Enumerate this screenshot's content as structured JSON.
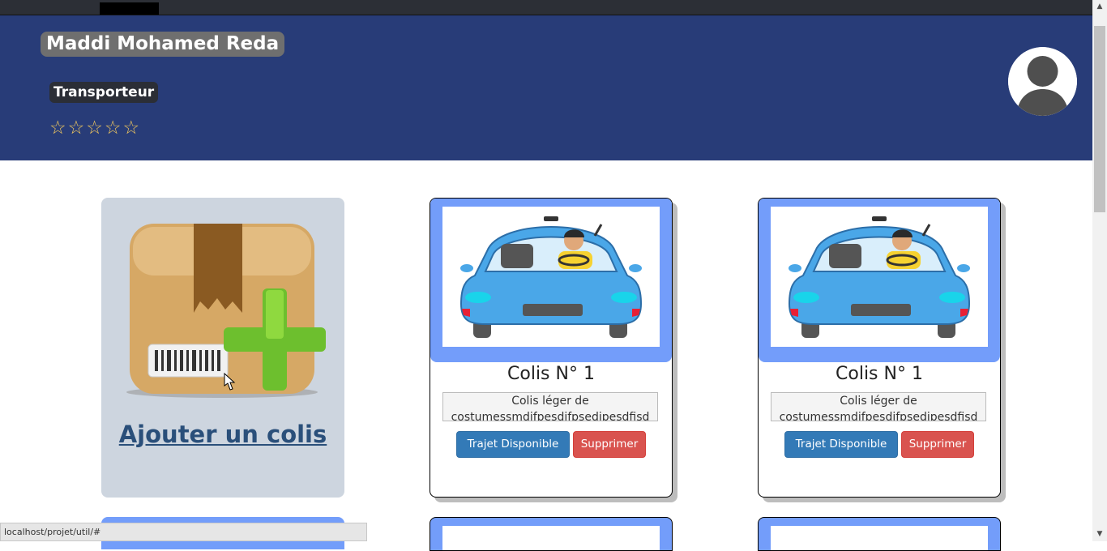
{
  "header": {
    "name": "Maddi Mohamed Reda",
    "role": "Transporteur",
    "stars": "☆☆☆☆☆",
    "rating_filled": 0,
    "rating_max": 5
  },
  "add_card": {
    "link_label": "Ajouter un colis"
  },
  "colis": [
    {
      "title": "Colis N° 1",
      "description": "Colis léger de costumessmdifpesdifpsedipesdfisd",
      "trajet_label": "Trajet Disponible",
      "supprimer_label": "Supprimer"
    },
    {
      "title": "Colis N° 1",
      "description": "Colis léger de costumessmdifpesdifpsedipesdfisd",
      "trajet_label": "Trajet Disponible",
      "supprimer_label": "Supprimer"
    }
  ],
  "status_url": "localhost/projet/util/#",
  "colors": {
    "header_bg": "#283c78",
    "card_accent": "#739dfa",
    "btn_primary": "#337ab7",
    "btn_danger": "#d9534f",
    "star": "#f0c75e"
  }
}
